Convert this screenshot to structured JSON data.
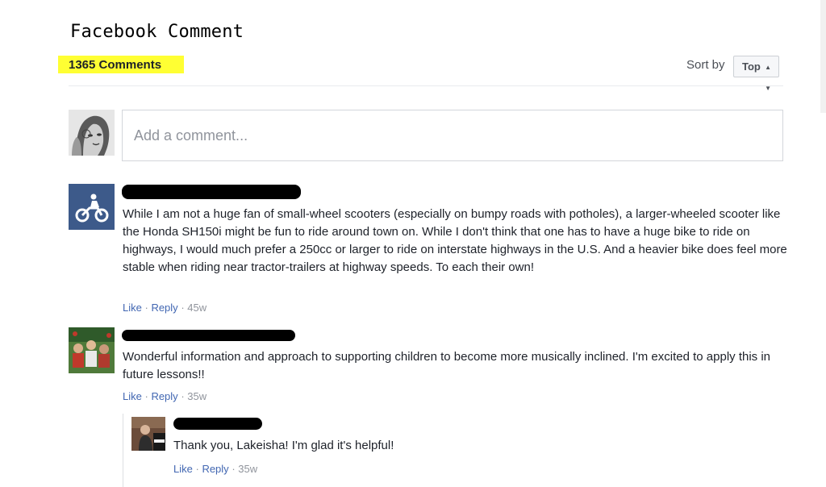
{
  "header": {
    "title": "Facebook Comment",
    "count_label": "1365 Comments",
    "sort_label": "Sort by",
    "sort_value": "Top"
  },
  "composer": {
    "placeholder": "Add a comment..."
  },
  "comments": [
    {
      "text": "While I am not a huge fan of small-wheel scooters (especially on bumpy roads with potholes), a larger-wheeled scooter like the Honda SH150i might be fun to ride around town on. While I don't think that one has to have a huge bike to ride on highways, I would much prefer a 250cc or larger to ride on interstate highways in the U.S. And a heavier bike does feel more stable when riding near tractor-trailers at highway speeds. To each their own!",
      "like": "Like",
      "reply": "Reply",
      "time": "45w"
    },
    {
      "text": "Wonderful information and approach to supporting children to become more musically inclined. I'm excited to apply this in future lessons!!",
      "like": "Like",
      "reply": "Reply",
      "time": "35w"
    },
    {
      "text": "Thank you, Lakeisha! I'm glad it's helpful!",
      "like": "Like",
      "reply": "Reply",
      "time": "35w"
    }
  ],
  "colors": {
    "highlight": "#ffff33",
    "link": "#4267b2",
    "meta": "#90949c"
  }
}
